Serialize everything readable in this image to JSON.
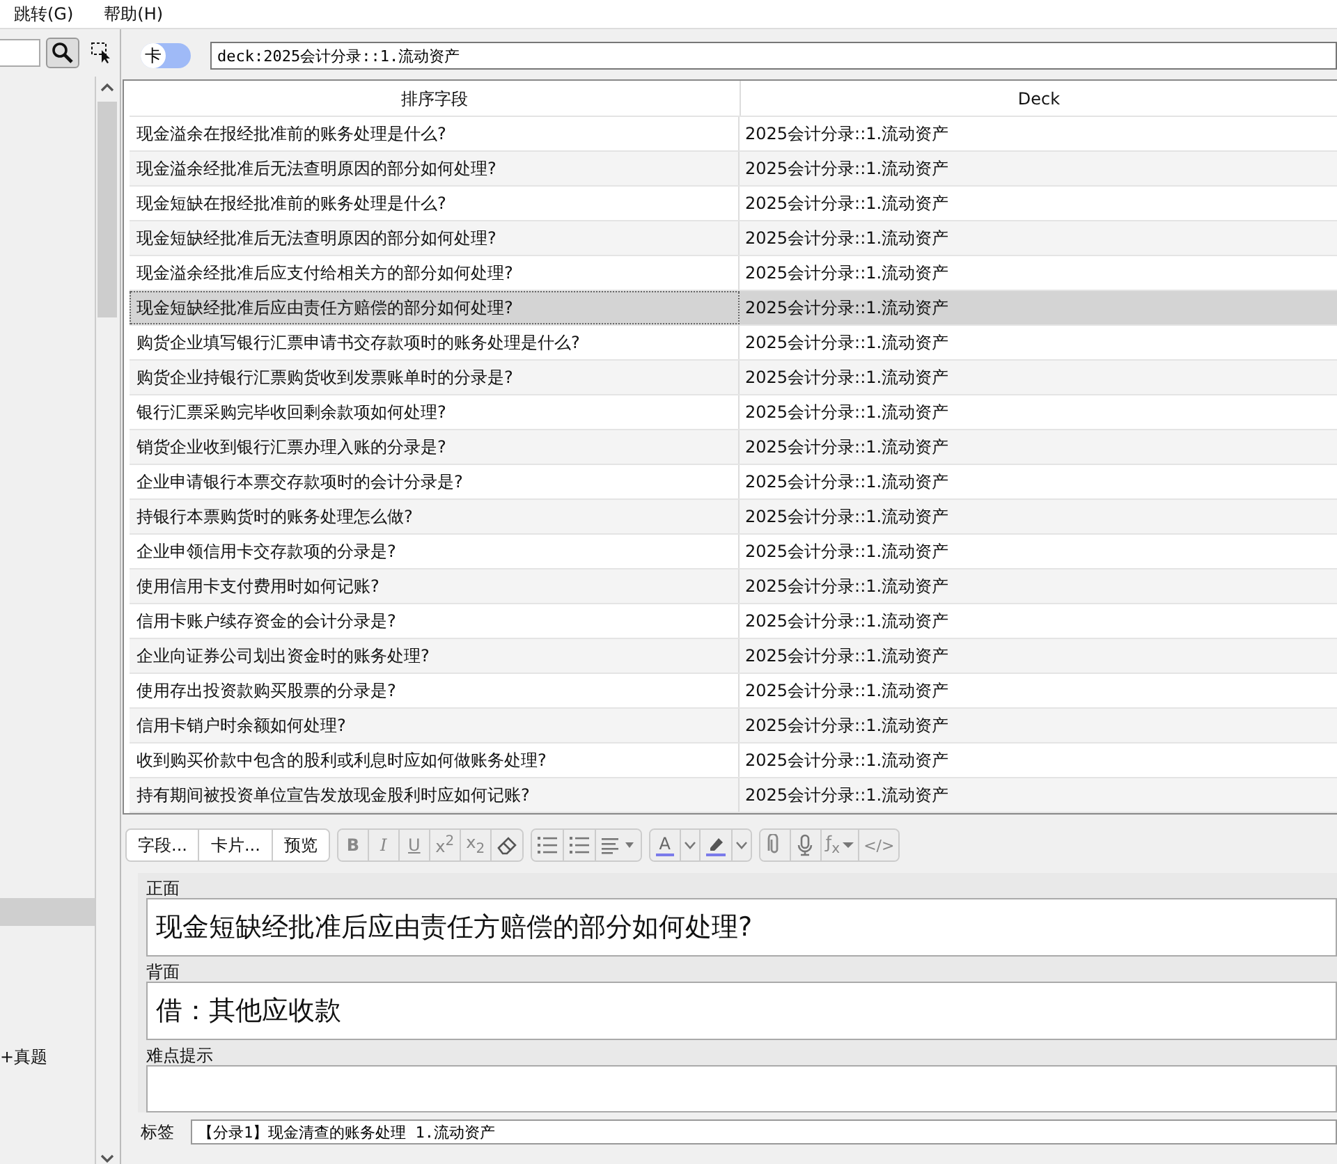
{
  "menu": [
    {
      "label": "跳转(G)"
    },
    {
      "label": "帮助(H)"
    }
  ],
  "sidebar": {
    "items": [
      {
        "selected": true
      },
      {
        "label": "+真题",
        "selected": false
      }
    ]
  },
  "mode_switch": {
    "label": "卡",
    "on": false
  },
  "search": {
    "value": "deck:2025会计分录::1.流动资产"
  },
  "table": {
    "columns": [
      "排序字段",
      "Deck"
    ],
    "rows": [
      {
        "cells": [
          "现金溢余在报经批准前的账务处理是什么?",
          "2025会计分录::1.流动资产"
        ],
        "selected": false
      },
      {
        "cells": [
          "现金溢余经批准后无法查明原因的部分如何处理?",
          "2025会计分录::1.流动资产"
        ],
        "selected": false
      },
      {
        "cells": [
          "现金短缺在报经批准前的账务处理是什么?",
          "2025会计分录::1.流动资产"
        ],
        "selected": false
      },
      {
        "cells": [
          "现金短缺经批准后无法查明原因的部分如何处理?",
          "2025会计分录::1.流动资产"
        ],
        "selected": false
      },
      {
        "cells": [
          "现金溢余经批准后应支付给相关方的部分如何处理?",
          "2025会计分录::1.流动资产"
        ],
        "selected": false
      },
      {
        "cells": [
          "现金短缺经批准后应由责任方赔偿的部分如何处理?",
          "2025会计分录::1.流动资产"
        ],
        "selected": true
      },
      {
        "cells": [
          "购货企业填写银行汇票申请书交存款项时的账务处理是什么?",
          "2025会计分录::1.流动资产"
        ],
        "selected": false
      },
      {
        "cells": [
          "购货企业持银行汇票购货收到发票账单时的分录是?",
          "2025会计分录::1.流动资产"
        ],
        "selected": false
      },
      {
        "cells": [
          "银行汇票采购完毕收回剩余款项如何处理?",
          "2025会计分录::1.流动资产"
        ],
        "selected": false
      },
      {
        "cells": [
          "销货企业收到银行汇票办理入账的分录是?",
          "2025会计分录::1.流动资产"
        ],
        "selected": false
      },
      {
        "cells": [
          "企业申请银行本票交存款项时的会计分录是?",
          "2025会计分录::1.流动资产"
        ],
        "selected": false
      },
      {
        "cells": [
          "持银行本票购货时的账务处理怎么做?",
          "2025会计分录::1.流动资产"
        ],
        "selected": false
      },
      {
        "cells": [
          "企业申领信用卡交存款项的分录是?",
          "2025会计分录::1.流动资产"
        ],
        "selected": false
      },
      {
        "cells": [
          "使用信用卡支付费用时如何记账?",
          "2025会计分录::1.流动资产"
        ],
        "selected": false
      },
      {
        "cells": [
          "信用卡账户续存资金的会计分录是?",
          "2025会计分录::1.流动资产"
        ],
        "selected": false
      },
      {
        "cells": [
          "企业向证券公司划出资金时的账务处理?",
          "2025会计分录::1.流动资产"
        ],
        "selected": false
      },
      {
        "cells": [
          "使用存出投资款购买股票的分录是?",
          "2025会计分录::1.流动资产"
        ],
        "selected": false
      },
      {
        "cells": [
          "信用卡销户时余额如何处理?",
          "2025会计分录::1.流动资产"
        ],
        "selected": false
      },
      {
        "cells": [
          "收到购买价款中包含的股利或利息时应如何做账务处理?",
          "2025会计分录::1.流动资产"
        ],
        "selected": false
      },
      {
        "cells": [
          "持有期间被投资单位宣告发放现金股利时应如何记账?",
          "2025会计分录::1.流动资产"
        ],
        "selected": false
      }
    ]
  },
  "toolbar": {
    "buttons": [
      "字段...",
      "卡片...",
      "预览"
    ],
    "groups": [
      [
        {
          "kind": "bold",
          "label": "B"
        },
        {
          "kind": "italic",
          "label": "I"
        },
        {
          "kind": "underline",
          "label": "U"
        },
        {
          "kind": "superscript",
          "label": "x$^{2}$"
        },
        {
          "kind": "subscript",
          "label": "x$_{2}$"
        },
        {
          "kind": "clear"
        }
      ],
      [
        {
          "kind": "bullets"
        },
        {
          "kind": "numbers"
        },
        {
          "kind": "align"
        }
      ],
      [
        {
          "kind": "text-color",
          "label": "A"
        },
        {
          "kind": "caret"
        },
        {
          "kind": "highlight"
        },
        {
          "kind": "caret"
        }
      ],
      [
        {
          "kind": "attach"
        },
        {
          "kind": "record"
        },
        {
          "kind": "formula",
          "label": "ƒ$_{x}$"
        },
        {
          "kind": "html",
          "label": "</>"
        }
      ]
    ]
  },
  "fields": [
    {
      "label": "正面",
      "value": "现金短缺经批准后应由责任方赔偿的部分如何处理?"
    },
    {
      "label": "背面",
      "value": "借：其他应收款"
    },
    {
      "label": "难点提示"
    }
  ],
  "tags": {
    "label": "标签",
    "value": "【分录1】现金清查的账务处理 1.流动资产"
  }
}
